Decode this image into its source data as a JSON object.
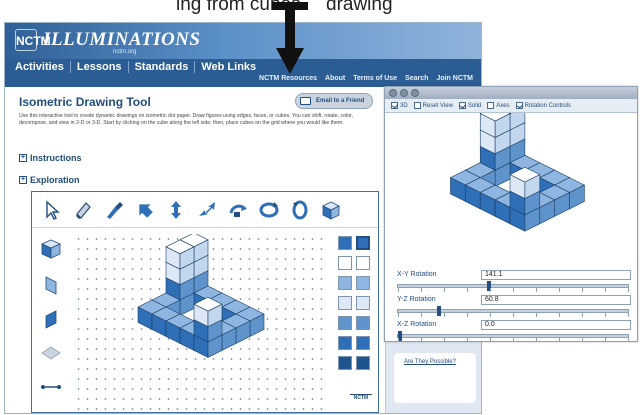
{
  "caption": {
    "left_text": "ing from cubes",
    "right_text": "drawing"
  },
  "site": {
    "logo_mark": "NCTM",
    "logo_text": "ILLUMINATIONS",
    "logo_sub": "nctm.org",
    "main_nav": [
      "Activities",
      "Lessons",
      "Standards",
      "Web Links"
    ],
    "sub_nav": [
      "NCTM Resources",
      "About",
      "Terms of Use",
      "Search",
      "Join NCTM"
    ]
  },
  "tool": {
    "title": "Isometric Drawing Tool",
    "email_label": "Email to a Friend",
    "description": "Use this interactive tool to create dynamic drawings on isometric dot paper. Draw figures using edges, faces, or cubes. You can shift, rotate, color, decompose, and view in 2-D or 3-D. Start by clicking on the cube along the left side; then, place cubes on the grid where you would like them.",
    "instructions_label": "Instructions",
    "exploration_label": "Exploration",
    "corner_logo": "NCTM"
  },
  "toolbar_icons": [
    "pointer-icon",
    "eraser-icon",
    "paint-icon",
    "shift-icon",
    "flip-vertical-icon",
    "flip-horizontal-icon",
    "rotate-view-icon",
    "rotate-cw-icon",
    "rotate-ccw-icon",
    "view-3d-icon"
  ],
  "palette_colors": [
    "#2e6fb7",
    "#2e6fb7",
    "#ffffff",
    "#ffffff",
    "#8fb6e0",
    "#8fb6e0",
    "#dce8f5",
    "#dce8f5",
    "#5f93cc",
    "#5f93cc",
    "#2e6fb7",
    "#2e6fb7",
    "#1f558f",
    "#1f558f"
  ],
  "popup": {
    "options": [
      {
        "label": "3D",
        "checked": true
      },
      {
        "label": "Reset View",
        "checked": false
      },
      {
        "label": "Solid",
        "checked": true
      },
      {
        "label": "Axes",
        "checked": false
      },
      {
        "label": "Rotation Controls",
        "checked": true
      }
    ],
    "rotations": [
      {
        "label": "X-Y Rotation",
        "value": "141.1",
        "level": 0.39
      },
      {
        "label": "Y-Z Rotation",
        "value": "60.8",
        "level": 0.17
      },
      {
        "label": "X-Z Rotation",
        "value": "0.0",
        "level": 0.0
      }
    ]
  },
  "side_links": [
    "Are They Possible?"
  ],
  "colors": {
    "accent": "#2b5c93",
    "cube_dark": "#2e6fb7",
    "cube_light": "#ffffff"
  }
}
